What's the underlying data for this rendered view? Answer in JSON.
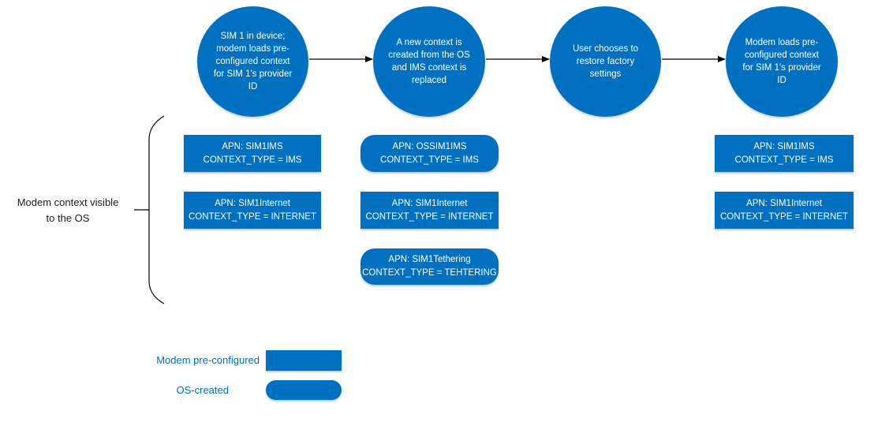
{
  "colors": {
    "modem_preconfigured": "#0070C0",
    "os_created": "#0070C0",
    "connector": "#000000",
    "legend_text": "#0070C0"
  },
  "steps": [
    {
      "id": "step-1",
      "text": "SIM 1 in device;\nmodem loads pre-\nconfigured context\nfor SIM 1's provider\nID"
    },
    {
      "id": "step-2",
      "text": "A new context is\ncreated from the OS\nand IMS context is\nreplaced"
    },
    {
      "id": "step-3",
      "text": "User chooses to\nrestore factory\nsettings"
    },
    {
      "id": "step-4",
      "text": "Modem loads pre-\nconfigured context\nfor SIM 1's provider\nID"
    }
  ],
  "side_label": "Modem context visible\nto the OS",
  "contexts": {
    "step_1": [
      {
        "kind": "modem-preconfigured",
        "apn": "APN: SIM1IMS",
        "type": "CONTEXT_TYPE = IMS"
      },
      {
        "kind": "modem-preconfigured",
        "apn": "APN: SIM1Internet",
        "type": "CONTEXT_TYPE = INTERNET"
      }
    ],
    "step_2": [
      {
        "kind": "os-created",
        "apn": "APN: OSSIM1IMS",
        "type": "CONTEXT_TYPE = IMS"
      },
      {
        "kind": "modem-preconfigured",
        "apn": "APN: SIM1Internet",
        "type": "CONTEXT_TYPE = INTERNET"
      },
      {
        "kind": "os-created",
        "apn": "APN: SIM1Tethering",
        "type": "CONTEXT_TYPE = TEHTERING"
      }
    ],
    "step_4": [
      {
        "kind": "modem-preconfigured",
        "apn": "APN: SIM1IMS",
        "type": "CONTEXT_TYPE = IMS"
      },
      {
        "kind": "modem-preconfigured",
        "apn": "APN: SIM1Internet",
        "type": "CONTEXT_TYPE = INTERNET"
      }
    ]
  },
  "legend": {
    "modem_preconfigured": "Modem pre-configured",
    "os_created": "OS-created"
  }
}
